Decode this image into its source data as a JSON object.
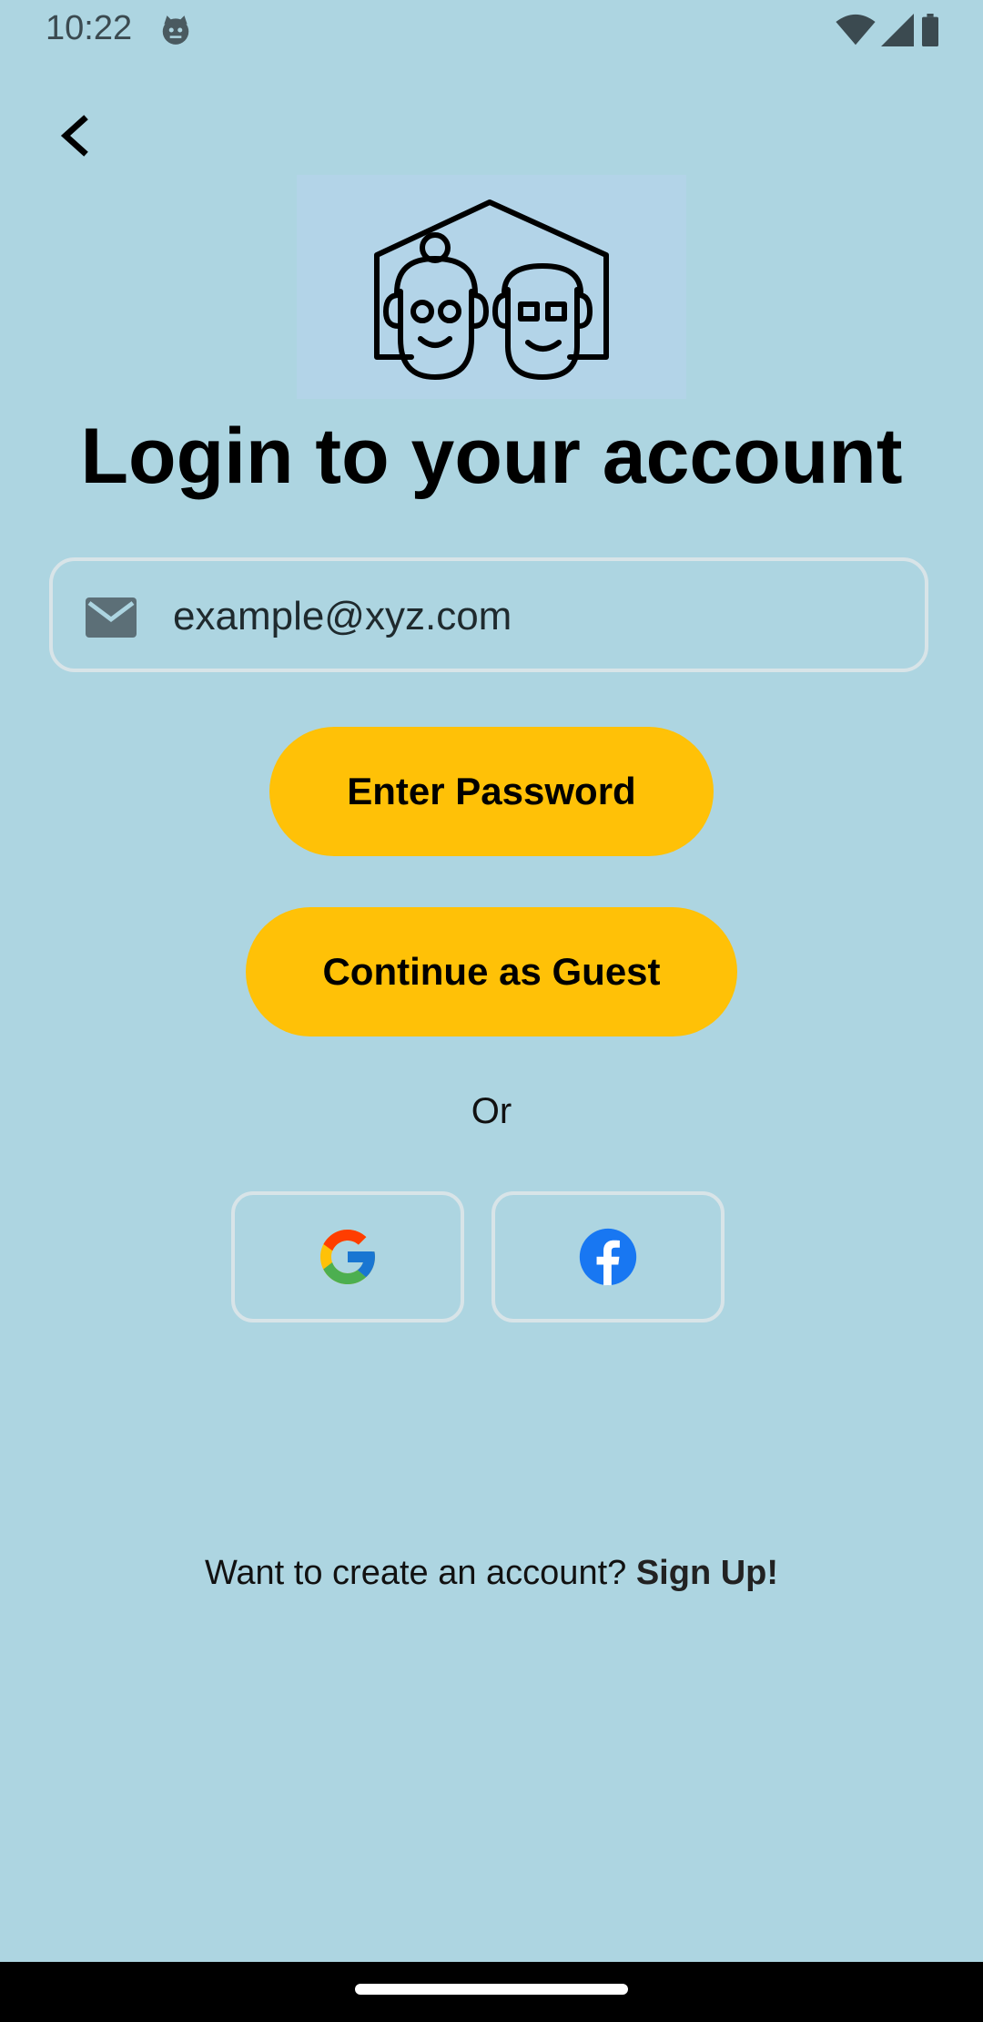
{
  "status_bar": {
    "time": "10:22",
    "icons": [
      "cat-notification-icon",
      "wifi-icon",
      "cellular-signal-icon",
      "battery-icon"
    ]
  },
  "header": {
    "back_icon": "chevron-left-icon"
  },
  "logo": {
    "icon": "elderly-couple-house-logo"
  },
  "page_title": "Login to your account",
  "email_field": {
    "icon": "mail-icon",
    "value": "example@xyz.com"
  },
  "buttons": {
    "enter_password": "Enter Password",
    "continue_guest": "Continue as Guest"
  },
  "divider_text": "Or",
  "social": {
    "google_icon": "google-logo-icon",
    "facebook_icon": "facebook-logo-icon"
  },
  "signup": {
    "prompt": "Want to create an account?",
    "link": "Sign Up!"
  },
  "colors": {
    "background": "#ADD5E1",
    "accent": "#FFC107",
    "logo_bg": "#B3D4E8",
    "facebook_blue": "#1877F2"
  }
}
